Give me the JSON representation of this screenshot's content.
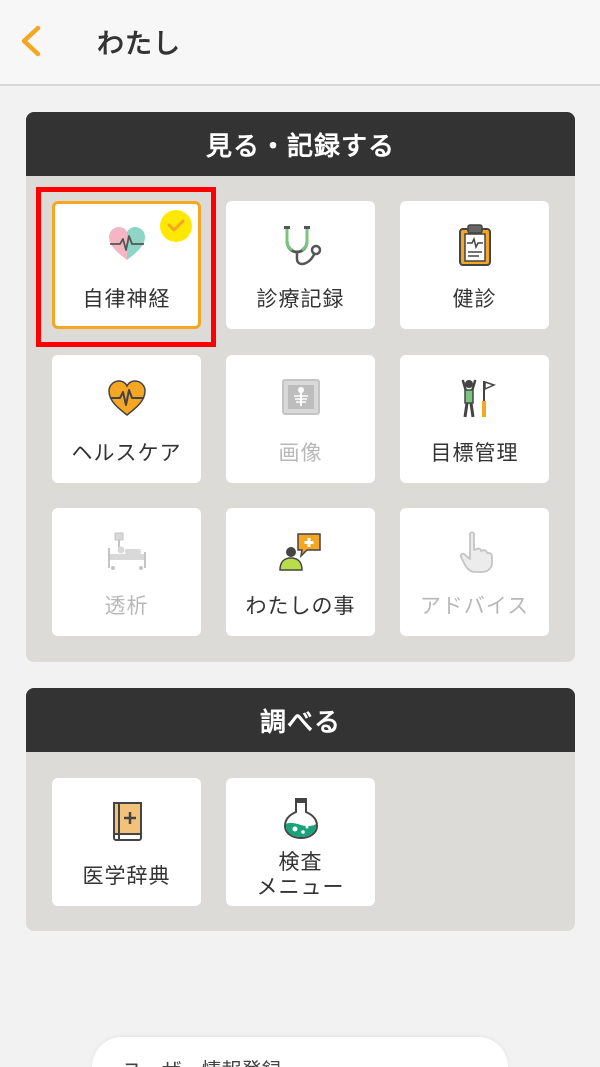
{
  "header": {
    "title": "わたし",
    "back_icon": "chevron-left-icon"
  },
  "colors": {
    "accent": "#f5a623",
    "section_header": "#333333",
    "section_bg": "#dddbd8",
    "highlight": "#ff0000",
    "check_badge": "#ffe800"
  },
  "record_section": {
    "title": "見る・記録する",
    "tiles": [
      {
        "label": "自律神経",
        "icon": "heart-pulse-icon",
        "enabled": true,
        "selected": true
      },
      {
        "label": "診療記録",
        "icon": "stethoscope-icon",
        "enabled": true,
        "selected": false
      },
      {
        "label": "健診",
        "icon": "clipboard-icon",
        "enabled": true,
        "selected": false
      },
      {
        "label": "ヘルスケア",
        "icon": "heart-monitor-icon",
        "enabled": true,
        "selected": false
      },
      {
        "label": "画像",
        "icon": "xray-image-icon",
        "enabled": false,
        "selected": false
      },
      {
        "label": "目標管理",
        "icon": "goal-flag-icon",
        "enabled": true,
        "selected": false
      },
      {
        "label": "透析",
        "icon": "dialysis-bed-icon",
        "enabled": false,
        "selected": false
      },
      {
        "label": "わたしの事",
        "icon": "person-speech-icon",
        "enabled": true,
        "selected": false
      },
      {
        "label": "アドバイス",
        "icon": "pointing-hand-icon",
        "enabled": false,
        "selected": false
      }
    ]
  },
  "search_section": {
    "title": "調べる",
    "tiles": [
      {
        "label": "医学辞典",
        "icon": "medical-book-icon"
      },
      {
        "label_line1": "検査",
        "label_line2": "メニュー",
        "icon": "flask-icon"
      }
    ]
  },
  "footer": {
    "button_label": "ユーザー情報登録"
  }
}
